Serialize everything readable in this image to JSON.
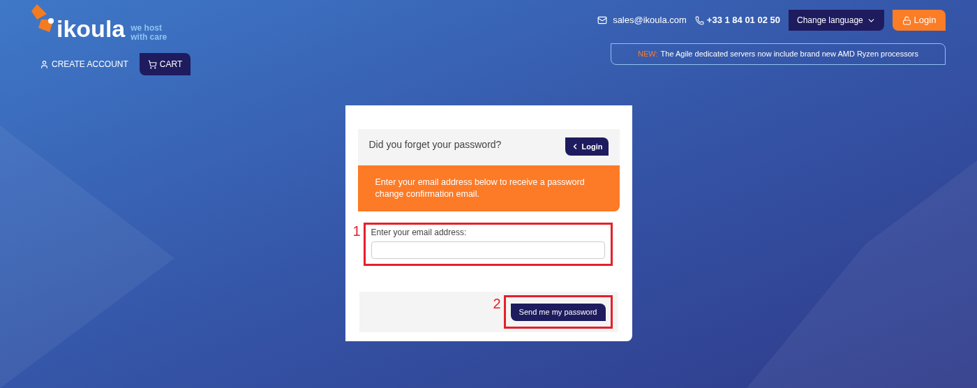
{
  "logo": {
    "name": "ikoula",
    "tagline": [
      "we host",
      "with care"
    ]
  },
  "header": {
    "email": "sales@ikoula.com",
    "phone": "+33 1 84 01 02 50",
    "language": "Change language",
    "login": "Login"
  },
  "nav": [
    {
      "label": "CREATE ACCOUNT",
      "kind": "link"
    },
    {
      "label": "CART",
      "kind": "button"
    }
  ],
  "news": {
    "tag": "NEW:",
    "text": "The Agile dedicated servers now include brand new AMD Ryzen processors"
  },
  "card": {
    "title": "Did you forget your password?",
    "back_button": "Login",
    "notice": "Enter your email address below to receive a password change confirmation email.",
    "field_label": "Enter your email address:",
    "submit": "Send me my password"
  },
  "annotations": [
    "1",
    "2"
  ]
}
